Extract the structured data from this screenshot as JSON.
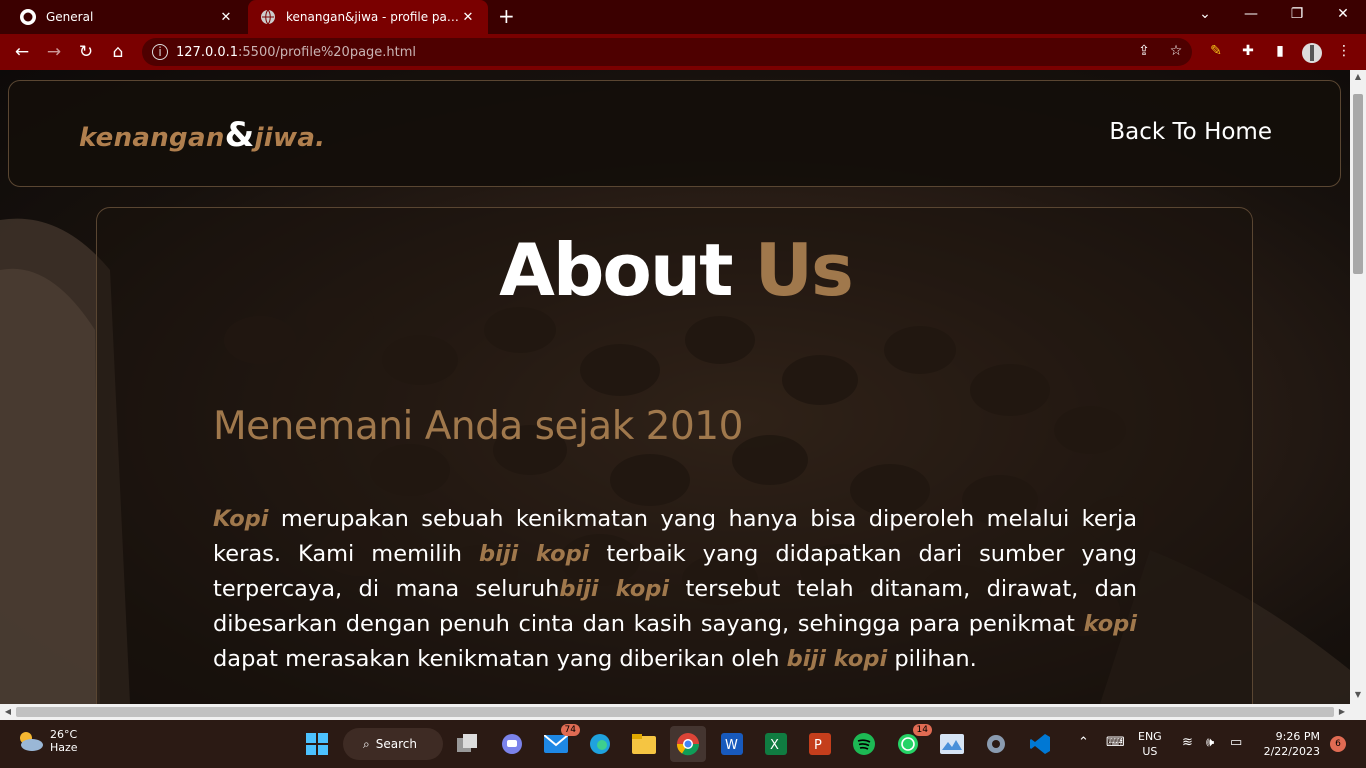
{
  "browser": {
    "tabs": [
      {
        "title": "General",
        "active": false
      },
      {
        "title": "kenangan&jiwa - profile page",
        "active": true
      }
    ],
    "url_host": "127.0.0.1",
    "url_path": ":5500/profile%20page.html"
  },
  "page": {
    "logo_main": "kenangan",
    "logo_amp": "&",
    "logo_end": "jiwa.",
    "back_home": "Back To Home",
    "about_title_main": "About",
    "about_title_accent": "Us",
    "since": "Menemani Anda sejak 2010",
    "desc": {
      "w1": "Kopi",
      "t1": " merupakan sebuah kenikmatan yang hanya bisa diperoleh melalui kerja keras. Kami memilih ",
      "w2": "biji kopi",
      "t2": " terbaik yang didapatkan dari sumber yang terpercaya, di mana seluruh",
      "w3": "biji kopi",
      "t3": " tersebut telah ditanam, dirawat, dan dibesarkan dengan penuh cinta dan kasih sayang, sehingga para penikmat ",
      "w4": "kopi",
      "t4": " dapat merasakan kenikmatan yang diberikan oleh ",
      "w5": "biji kopi",
      "t5": " pilihan."
    }
  },
  "taskbar": {
    "weather_temp": "26°C",
    "weather_desc": "Haze",
    "search_label": "Search",
    "mail_badge": "74",
    "whatsapp_badge": "14",
    "lang_top": "ENG",
    "lang_bottom": "US",
    "time": "9:26 PM",
    "date": "2/22/2023",
    "notifications": "6"
  },
  "colors": {
    "accent": "#a0784c",
    "chrome": "#7a0000",
    "tabbar": "#3b0000"
  }
}
